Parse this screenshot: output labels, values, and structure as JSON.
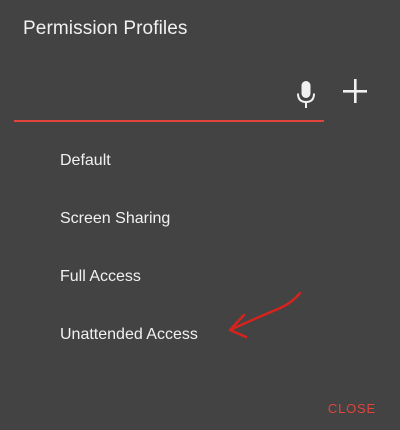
{
  "dialog": {
    "title": "Permission Profiles",
    "search": {
      "value": "",
      "placeholder": ""
    },
    "icons": {
      "mic": "microphone-icon",
      "add": "plus-icon"
    },
    "profiles": [
      {
        "label": "Default"
      },
      {
        "label": "Screen Sharing"
      },
      {
        "label": "Full Access"
      },
      {
        "label": "Unattended Access"
      }
    ],
    "close_label": "CLOSE",
    "colors": {
      "background": "#434343",
      "accent": "#e0443c",
      "text": "#f1f1f1"
    }
  }
}
